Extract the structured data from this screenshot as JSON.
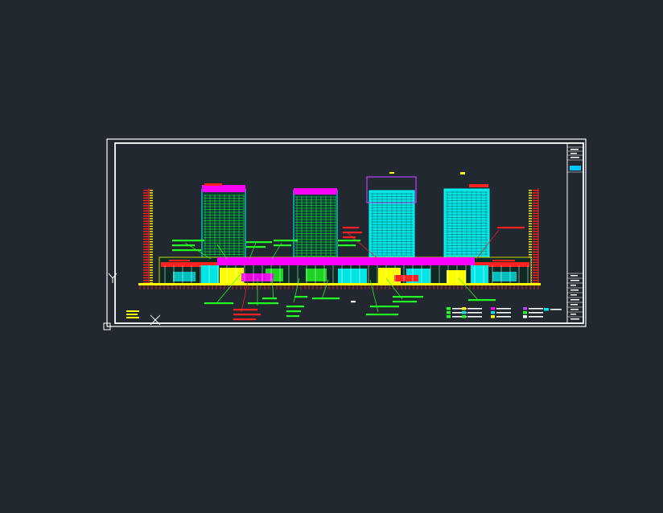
{
  "canvas": {
    "background": "#212830",
    "frame_color": "#ffffff"
  },
  "colors": {
    "cyan": "#00ffff",
    "magenta": "#ff00ff",
    "red": "#ff2020",
    "green": "#22ff22",
    "yellow": "#ffff00",
    "white": "#ffffff",
    "purple": "#c040ff"
  },
  "icons": {
    "ucs": "ucs-axis-icon",
    "cursor": "crosshair-cursor-icon"
  }
}
